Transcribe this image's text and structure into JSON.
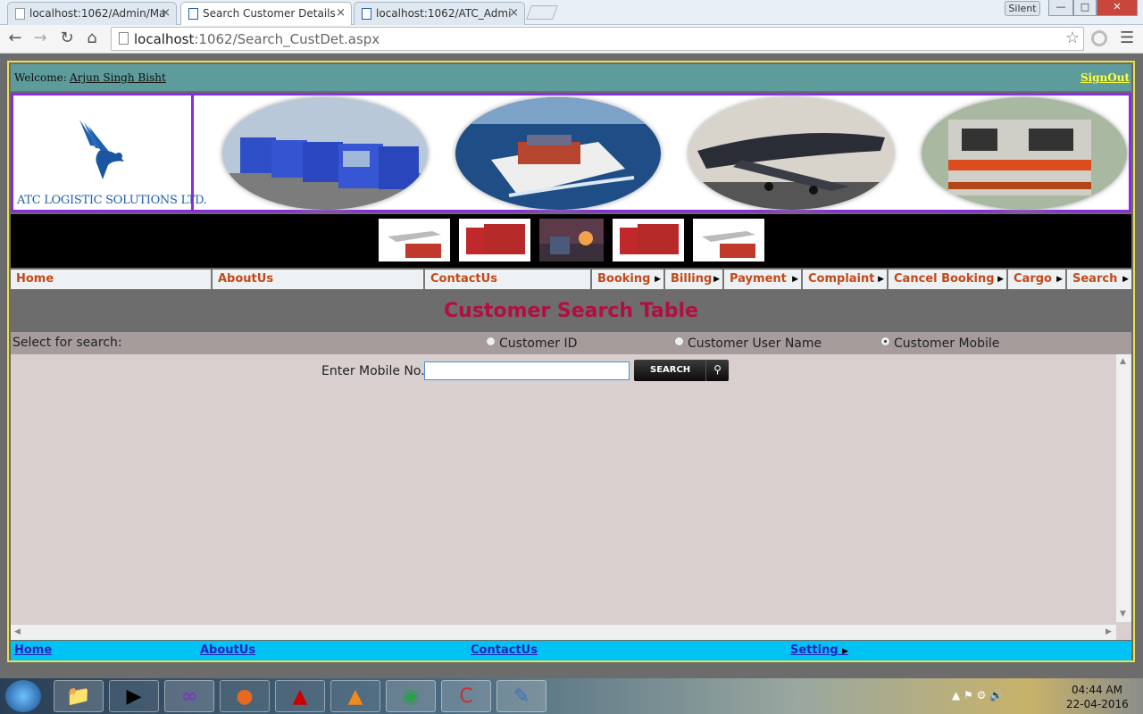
{
  "browser": {
    "tabs": [
      {
        "title": "localhost:1062/Admin/Ma"
      },
      {
        "title": "Search Customer Details"
      },
      {
        "title": "localhost:1062/ATC_Admi"
      }
    ],
    "close_glyph": "×",
    "silent_label": "Silent",
    "url_host": "localhost",
    "url_path": ":1062/Search_CustDet.aspx",
    "window_controls": {
      "minimize": "—",
      "maximize": "□",
      "close": "✕"
    },
    "nav_icons": {
      "back": "back-arrow-icon",
      "forward": "forward-arrow-icon",
      "reload": "reload-icon",
      "home": "home-icon"
    }
  },
  "header": {
    "welcome_label": "Welcome:",
    "user_name": "Arjun Singh Bisht",
    "signout": "SignOut"
  },
  "logo": {
    "company": "ATC LOGISTIC SOLUTIONS LTD."
  },
  "menu": {
    "items": [
      {
        "label": "Home",
        "has_submenu": false
      },
      {
        "label": "AboutUs",
        "has_submenu": false
      },
      {
        "label": "ContactUs",
        "has_submenu": false
      },
      {
        "label": "Booking",
        "has_submenu": true
      },
      {
        "label": "Billing",
        "has_submenu": true
      },
      {
        "label": "Payment",
        "has_submenu": true
      },
      {
        "label": "Complaint",
        "has_submenu": true
      },
      {
        "label": "Cancel Booking",
        "has_submenu": true
      },
      {
        "label": "Cargo",
        "has_submenu": true
      },
      {
        "label": "Search",
        "has_submenu": true
      }
    ]
  },
  "main": {
    "title": "Customer Search Table",
    "select_label": "Select for search:",
    "radios": [
      {
        "label": "Customer ID",
        "checked": false
      },
      {
        "label": "Customer User Name",
        "checked": false
      },
      {
        "label": "Customer Mobile",
        "checked": true
      }
    ],
    "mobile_label": "Enter Mobile No.:",
    "mobile_value": "",
    "search_button": "SEARCH"
  },
  "footer": {
    "links": [
      {
        "label": "Home"
      },
      {
        "label": "AboutUs"
      },
      {
        "label": "ContactUs"
      },
      {
        "label": "Setting"
      }
    ]
  },
  "taskbar": {
    "time": "04:44 AM",
    "date": "22-04-2016"
  },
  "colors": {
    "welcome_bar": "#5e9b9b",
    "banner_border": "#8a2be2",
    "menu_text": "#c24a1a",
    "title_text": "#b01040",
    "footer_bg": "#00c3f5",
    "signout": "#ffff33"
  }
}
